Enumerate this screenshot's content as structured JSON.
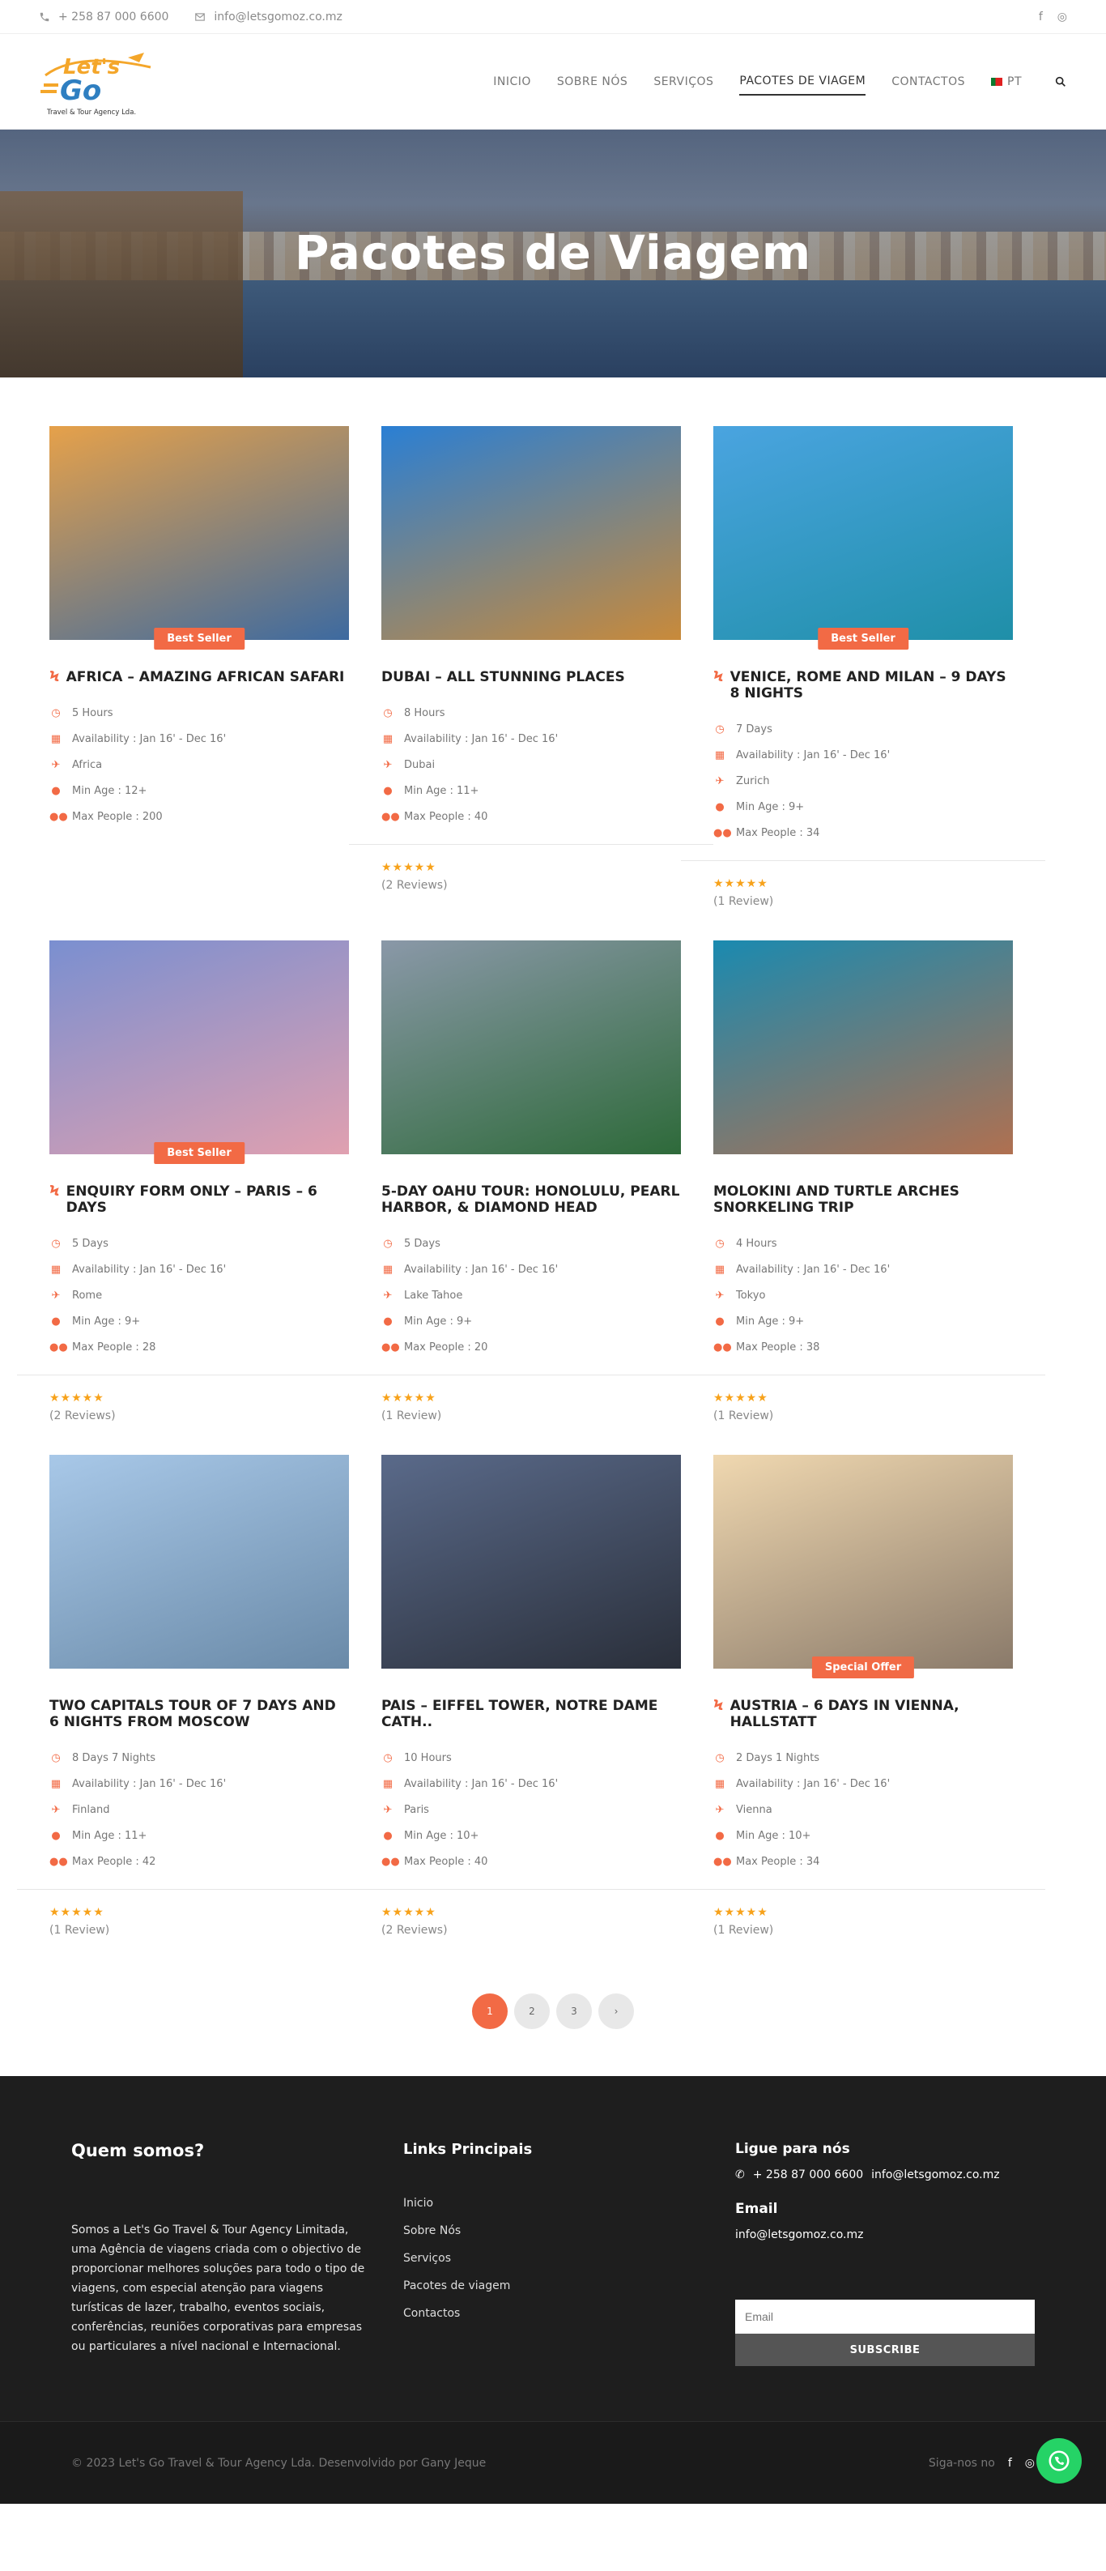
{
  "topbar": {
    "phone": "+ 258 87 000 6600",
    "email": "info@letsgomoz.co.mz",
    "social": [
      "facebook-icon",
      "instagram-icon"
    ]
  },
  "header": {
    "logo_text": "Let's Go",
    "logo_sub": "Travel & Tour Agency Lda.",
    "nav": [
      "INICIO",
      "SOBRE NÓS",
      "SERVIÇOS",
      "PACOTES DE VIAGEM",
      "CONTACTOS"
    ],
    "active_nav": "PACOTES DE VIAGEM",
    "lang": "PT"
  },
  "hero": {
    "title": "Pacotes de Viagem"
  },
  "tours": [
    {
      "title": "AFRICA – AMAZING AFRICAN SAFARI",
      "bolt": true,
      "badge": "Best Seller",
      "duration": "5 Hours",
      "availability": "Availability : Jan 16' - Dec 16'",
      "location": "Africa",
      "min_age": "Min Age : 12+",
      "max_people": "Max People : 200",
      "stars": "",
      "reviews": "",
      "colors": [
        "#e6a14a",
        "#3d6aa0"
      ]
    },
    {
      "title": "DUBAI – ALL STUNNING PLACES",
      "bolt": false,
      "badge": "",
      "duration": "8 Hours",
      "availability": "Availability : Jan 16' - Dec 16'",
      "location": "Dubai",
      "min_age": "Min Age : 11+",
      "max_people": "Max People : 40",
      "stars": "★★★★★",
      "reviews": "(2 Reviews)",
      "colors": [
        "#2a7fd4",
        "#c98a3a"
      ]
    },
    {
      "title": "VENICE, ROME AND MILAN – 9 DAYS 8 NIGHTS",
      "bolt": true,
      "badge": "Best Seller",
      "duration": "7 Days",
      "availability": "Availability : Jan 16' - Dec 16'",
      "location": "Zurich",
      "min_age": "Min Age : 9+",
      "max_people": "Max People : 34",
      "stars": "★★★★★",
      "reviews": "(1 Review)",
      "colors": [
        "#4aa4e0",
        "#1f8fa8"
      ]
    },
    {
      "title": "ENQUIRY FORM ONLY – PARIS – 6 DAYS",
      "bolt": true,
      "badge": "Best Seller",
      "duration": "5 Days",
      "availability": "Availability : Jan 16' - Dec 16'",
      "location": "Rome",
      "min_age": "Min Age : 9+",
      "max_people": "Max People : 28",
      "stars": "★★★★★",
      "reviews": "(2 Reviews)",
      "colors": [
        "#7a8fd0",
        "#e0a0b0"
      ]
    },
    {
      "title": "5-DAY OAHU TOUR: HONOLULU, PEARL HARBOR, & DIAMOND HEAD",
      "bolt": false,
      "badge": "",
      "duration": "5 Days",
      "availability": "Availability : Jan 16' - Dec 16'",
      "location": "Lake Tahoe",
      "min_age": "Min Age : 9+",
      "max_people": "Max People : 20",
      "stars": "★★★★★",
      "reviews": "(1 Review)",
      "colors": [
        "#8a98a8",
        "#2e6a3a"
      ]
    },
    {
      "title": "MOLOKINI AND TURTLE ARCHES SNORKELING TRIP",
      "bolt": false,
      "badge": "",
      "duration": "4 Hours",
      "availability": "Availability : Jan 16' - Dec 16'",
      "location": "Tokyo",
      "min_age": "Min Age : 9+",
      "max_people": "Max People : 38",
      "stars": "★★★★★",
      "reviews": "(1 Review)",
      "colors": [
        "#1a8ab0",
        "#b07050"
      ]
    },
    {
      "title": "TWO CAPITALS TOUR OF 7 DAYS AND 6 NIGHTS FROM MOSCOW",
      "bolt": false,
      "badge": "",
      "duration": "8 Days 7 Nights",
      "availability": "Availability : Jan 16' - Dec 16'",
      "location": "Finland",
      "min_age": "Min Age : 11+",
      "max_people": "Max People : 42",
      "stars": "★★★★★",
      "reviews": "(1 Review)",
      "colors": [
        "#a8c8e8",
        "#6a8aa8"
      ]
    },
    {
      "title": "PAIS – EIFFEL TOWER, NOTRE DAME CATH..",
      "bolt": false,
      "badge": "",
      "duration": "10 Hours",
      "availability": "Availability : Jan 16' - Dec 16'",
      "location": "Paris",
      "min_age": "Min Age : 10+",
      "max_people": "Max People : 40",
      "stars": "★★★★★",
      "reviews": "(2 Reviews)",
      "colors": [
        "#5a6a8a",
        "#2a2f3a"
      ]
    },
    {
      "title": "AUSTRIA – 6 DAYS IN VIENNA, HALLSTATT",
      "bolt": true,
      "badge": "Special Offer",
      "duration": "2 Days 1 Nights",
      "availability": "Availability : Jan 16' - Dec 16'",
      "location": "Vienna",
      "min_age": "Min Age : 10+",
      "max_people": "Max People : 34",
      "stars": "★★★★★",
      "reviews": "(1 Review)",
      "colors": [
        "#f0d8b0",
        "#8a7a6a"
      ]
    }
  ],
  "pagination": {
    "pages": [
      "1",
      "2",
      "3",
      "›"
    ],
    "active": "1"
  },
  "footer": {
    "about_title": "Quem somos?",
    "about_text": "Somos a Let's Go Travel & Tour Agency Limitada, uma Agência de viagens criada com o objectivo de proporcionar melhores soluções para todo o tipo de viagens, com especial atenção para viagens turísticas de lazer, trabalho, eventos sociais, conferências, reuniões corporativas para empresas ou particulares a nível nacional e Internacional.",
    "links_title": "Links Principais",
    "links": [
      "Inicio",
      "Sobre Nós",
      "Serviços",
      "Pacotes de viagem",
      "Contactos"
    ],
    "call_title": "Ligue para nós",
    "call_phone": "+ 258 87 000 6600",
    "call_email": "info@letsgomoz.co.mz",
    "email_title": "Email",
    "email_value": "info@letsgomoz.co.mz",
    "email_placeholder": "Email",
    "subscribe_label": "SUBSCRIBE",
    "copyright": "© 2023 Let's Go Travel & Tour Agency Lda. Desenvolvido por Gany Jeque",
    "follow": "Siga-nos no"
  },
  "colors": {
    "accent": "#f26a45",
    "star": "#f7a21b",
    "footer_bg": "#1e1e1e",
    "whatsapp": "#25d366"
  }
}
